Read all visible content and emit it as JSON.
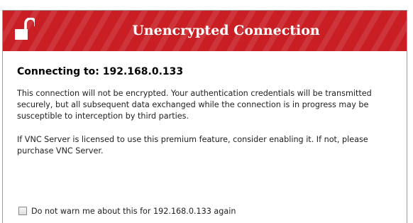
{
  "header": {
    "title": "Unencrypted Connection",
    "icon": "unlocked-padlock-icon",
    "background_color": "#c81e24"
  },
  "body": {
    "connecting_label": "Connecting to: 192.168.0.133",
    "paragraph1": "This connection will not be encrypted. Your authentication credentials will be transmitted securely, but all subsequent data exchanged while the connection is in progress may be susceptible to interception by third parties.",
    "paragraph2": "If VNC Server is licensed to use this premium feature, consider enabling it. If not, please purchase VNC Server."
  },
  "checkbox": {
    "label": "Do not warn me about this for 192.168.0.133 again",
    "checked": false
  }
}
